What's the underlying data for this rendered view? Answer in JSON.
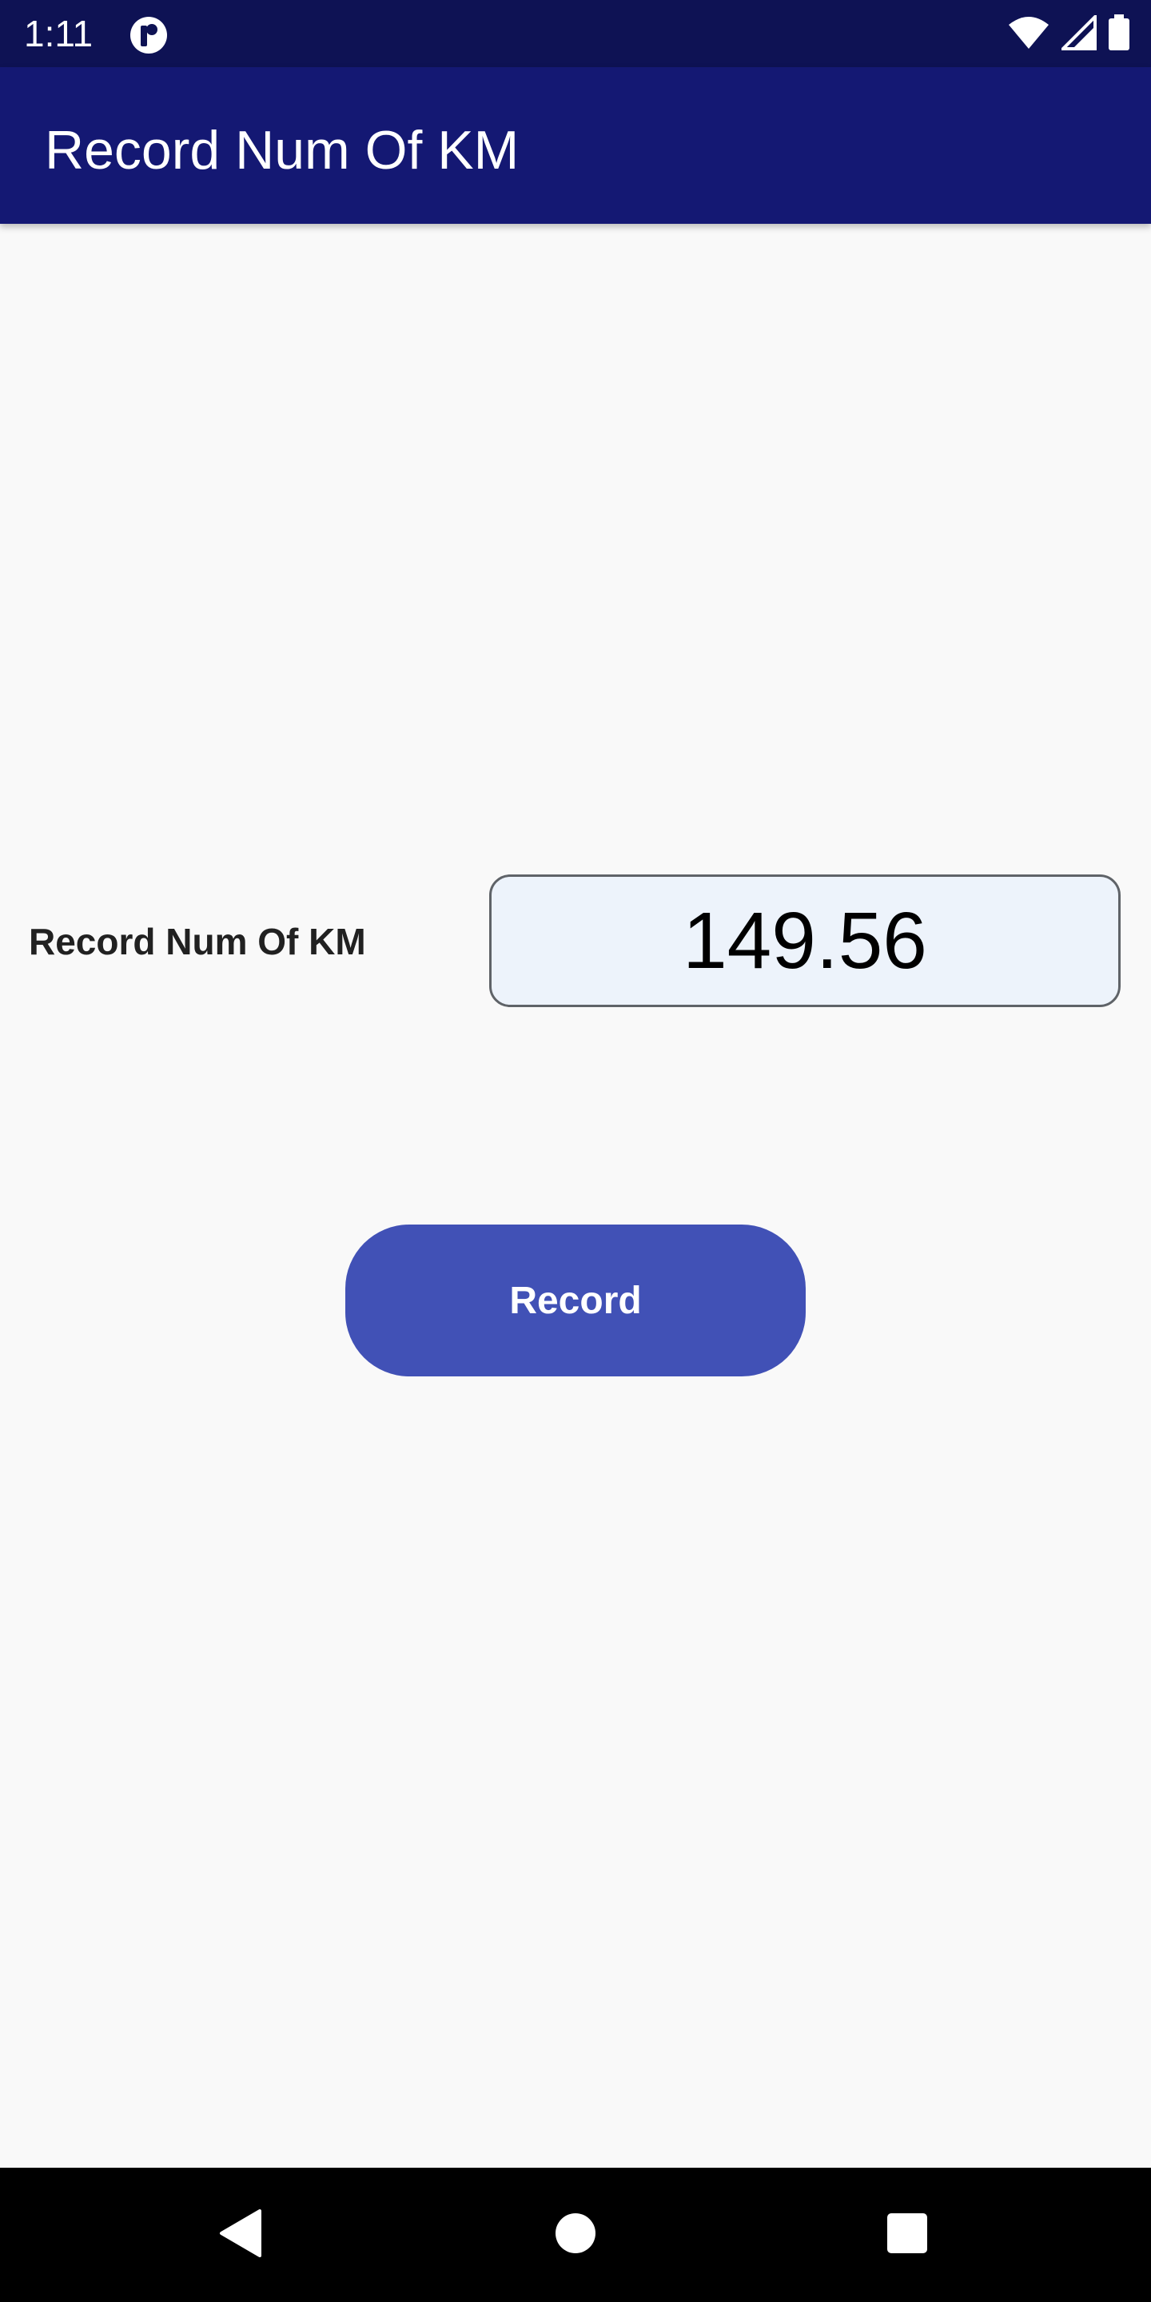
{
  "status_bar": {
    "time": "1:11",
    "icons": [
      "app-notification-icon",
      "wifi-icon",
      "signal-icon",
      "battery-icon"
    ]
  },
  "app_bar": {
    "title": "Record Num Of KM"
  },
  "form": {
    "label": "Record Num Of KM",
    "km_value": "149.56"
  },
  "record_button": {
    "label": "Record"
  },
  "nav_bar": {
    "icons": [
      "back-icon",
      "home-icon",
      "recents-icon"
    ]
  },
  "colors": {
    "status_bar": "#0e1254",
    "app_bar": "#141873",
    "button": "#4151b6",
    "input_bg": "#edf3fb",
    "background": "#f9f9f9"
  }
}
